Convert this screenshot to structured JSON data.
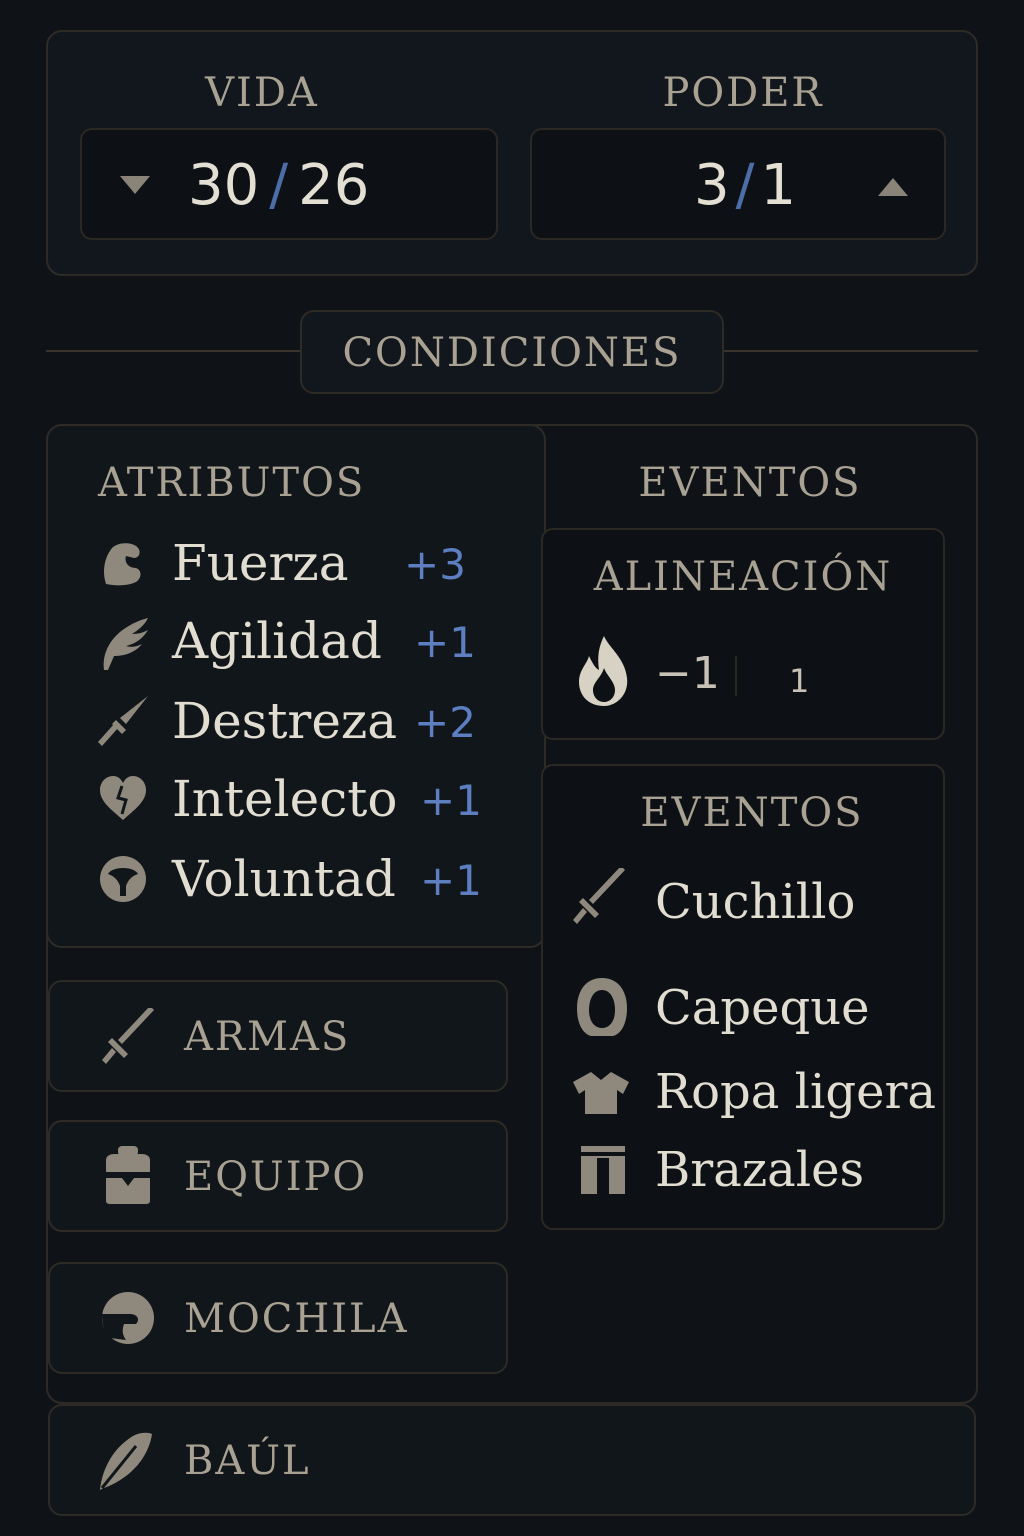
{
  "stats": {
    "vida": {
      "label": "VIDA",
      "current": "30",
      "sep": "/",
      "max": "26"
    },
    "poder": {
      "label": "PODER",
      "current": "3",
      "sep": "/",
      "max": "1"
    }
  },
  "conditions_label": "CONDICIONES",
  "attributes": {
    "title": "ATRIBUTOS",
    "items": [
      {
        "name": "Fuerza",
        "value": "+3",
        "icon": "arm-icon"
      },
      {
        "name": "Agilidad",
        "value": "+1",
        "icon": "wing-icon"
      },
      {
        "name": "Destreza",
        "value": "+2",
        "icon": "dagger-icon"
      },
      {
        "name": "Intelecto",
        "value": "+1",
        "icon": "heart-icon"
      },
      {
        "name": "Voluntad",
        "value": "+1",
        "icon": "mask-icon"
      }
    ]
  },
  "events_header": "EVENTOS",
  "alignment": {
    "title": "ALINEACIÓN",
    "value_left": "−1",
    "value_right": "1",
    "icon": "fire-icon"
  },
  "events": {
    "title": "EVENTOS",
    "items": [
      {
        "label": "Cuchillo",
        "icon": "sword-icon"
      },
      {
        "label": "Capeque",
        "icon": "hood-icon"
      },
      {
        "label": "Ropa ligera",
        "icon": "shirt-icon"
      },
      {
        "label": "Brazales",
        "icon": "bracers-icon"
      }
    ]
  },
  "menu": [
    {
      "label": "ARMAS",
      "icon": "sword-icon"
    },
    {
      "label": "EQUIPO",
      "icon": "backpack-icon"
    },
    {
      "label": "MOCHILA",
      "icon": "bag-icon"
    },
    {
      "label": "BAÚL",
      "icon": "feather-icon"
    }
  ],
  "colors": {
    "accent": "#5d7ec0",
    "text": "#e2ddd1",
    "muted": "#a9a293",
    "background": "#0f1318"
  }
}
